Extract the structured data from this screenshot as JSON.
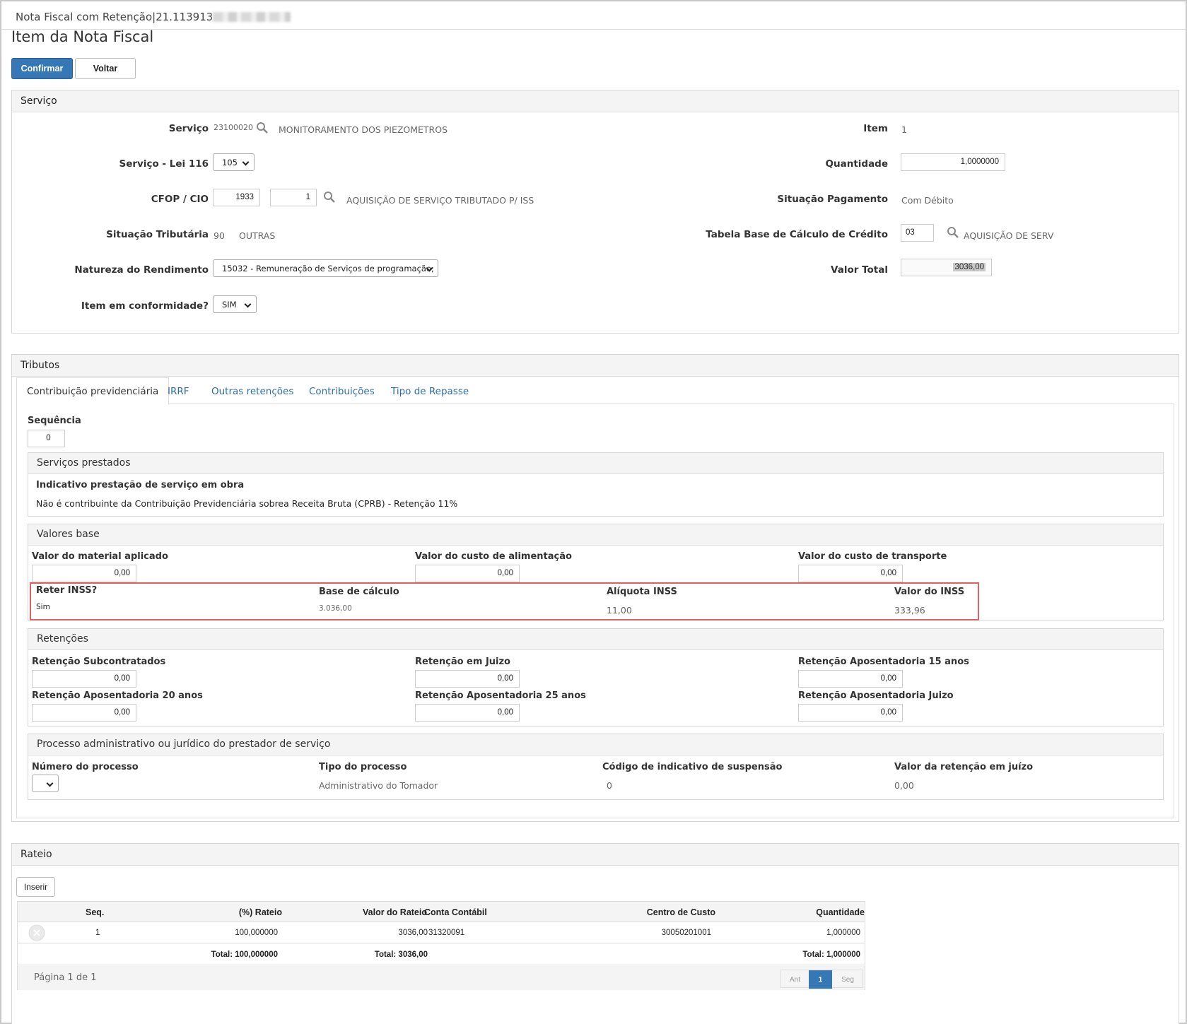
{
  "window": {
    "title": "Nota Fiscal com Retenção|21.113913"
  },
  "page": {
    "title": "Item da Nota Fiscal"
  },
  "actions": {
    "confirm": "Confirmar",
    "back": "Voltar"
  },
  "servico": {
    "panel_title": "Serviço",
    "servico_label": "Serviço",
    "servico_code": "23100020",
    "servico_desc": "MONITORAMENTO DOS PIEZOMETROS",
    "lei116_label": "Serviço - Lei 116",
    "lei116_value": "105",
    "cfop_label": "CFOP / CIO",
    "cfop_value": "1933",
    "cio_value": "1",
    "cfop_desc": "AQUISIÇÃO DE SERVIÇO TRIBUTADO P/ ISS",
    "sit_trib_label": "Situação Tributária",
    "sit_trib_code": "90",
    "sit_trib_desc": "OUTRAS",
    "natureza_label": "Natureza do Rendimento",
    "natureza_value": "15032 - Remuneração de Serviços de programação;",
    "conformidade_label": "Item em conformidade?",
    "conformidade_value": "SIM",
    "item_label": "Item",
    "item_value": "1",
    "quantidade_label": "Quantidade",
    "quantidade_value": "1,0000000",
    "sit_pag_label": "Situação Pagamento",
    "sit_pag_value": "Com Débito",
    "tabela_label": "Tabela Base de Cálculo de Crédito",
    "tabela_value": "03",
    "tabela_desc": "AQUISIÇÃO DE SERV",
    "valor_total_label": "Valor Total",
    "valor_total_value": "3036,00"
  },
  "tributos": {
    "panel_title": "Tributos",
    "tabs": [
      "Contribuição previdenciária",
      "IRRF",
      "Outras retenções",
      "Contribuições",
      "Tipo de Repasse"
    ],
    "sequencia_label": "Sequência",
    "sequencia_value": "0",
    "servicos_prestados": {
      "title": "Serviços prestados",
      "label": "Indicativo prestação de serviço em obra",
      "value": "Não é contribuinte da Contribuição Previdenciária sobrea Receita Bruta (CPRB) - Retenção 11%"
    },
    "valores_base": {
      "title": "Valores base",
      "material_label": "Valor do material aplicado",
      "material_value": "0,00",
      "alimentacao_label": "Valor do custo de alimentação",
      "alimentacao_value": "0,00",
      "transporte_label": "Valor do custo de transporte",
      "transporte_value": "0,00",
      "reter_label": "Reter INSS?",
      "reter_value": "Sim",
      "base_label": "Base de cálculo",
      "base_value": "3.036,00",
      "aliquota_label": "Alíquota INSS",
      "aliquota_value": "11,00",
      "valor_inss_label": "Valor do INSS",
      "valor_inss_value": "333,96"
    },
    "retencoes": {
      "title": "Retenções",
      "subcontratados_label": "Retenção Subcontratados",
      "subcontratados_value": "0,00",
      "juizo_label": "Retenção em Juizo",
      "juizo_value": "0,00",
      "apos15_label": "Retenção Aposentadoria 15 anos",
      "apos15_value": "0,00",
      "apos20_label": "Retenção Aposentadoria 20 anos",
      "apos20_value": "0,00",
      "apos25_label": "Retenção Aposentadoria 25 anos",
      "apos25_value": "0,00",
      "apos_juizo_label": "Retenção Aposentadoria Juizo",
      "apos_juizo_value": "0,00"
    },
    "processo": {
      "title": "Processo administrativo ou jurídico do prestador de serviço",
      "numero_label": "Número do processo",
      "tipo_label": "Tipo do processo",
      "tipo_value": "Administrativo do Tomador",
      "codigo_label": "Código de indicativo de suspensão",
      "codigo_value": "0",
      "valor_label": "Valor da retenção em juízo",
      "valor_value": "0,00"
    }
  },
  "rateio": {
    "panel_title": "Rateio",
    "insert_label": "Inserir",
    "columns": [
      "Seq.",
      "(%) Rateio",
      "Valor do Rateio",
      "Conta Contábil",
      "Centro de Custo",
      "Quantidade"
    ],
    "rows": [
      {
        "seq": "1",
        "rateio": "100,000000",
        "valor": "3036,00",
        "conta": "31320091",
        "centro": "30050201001",
        "quantidade": "1,000000"
      }
    ],
    "totals": {
      "rateio": "Total: 100,000000",
      "valor": "Total: 3036,00",
      "quantidade": "Total: 1,000000"
    },
    "pagination": {
      "info": "Página 1 de 1",
      "prev": "Ant",
      "current": "1",
      "next": "Seg"
    }
  }
}
